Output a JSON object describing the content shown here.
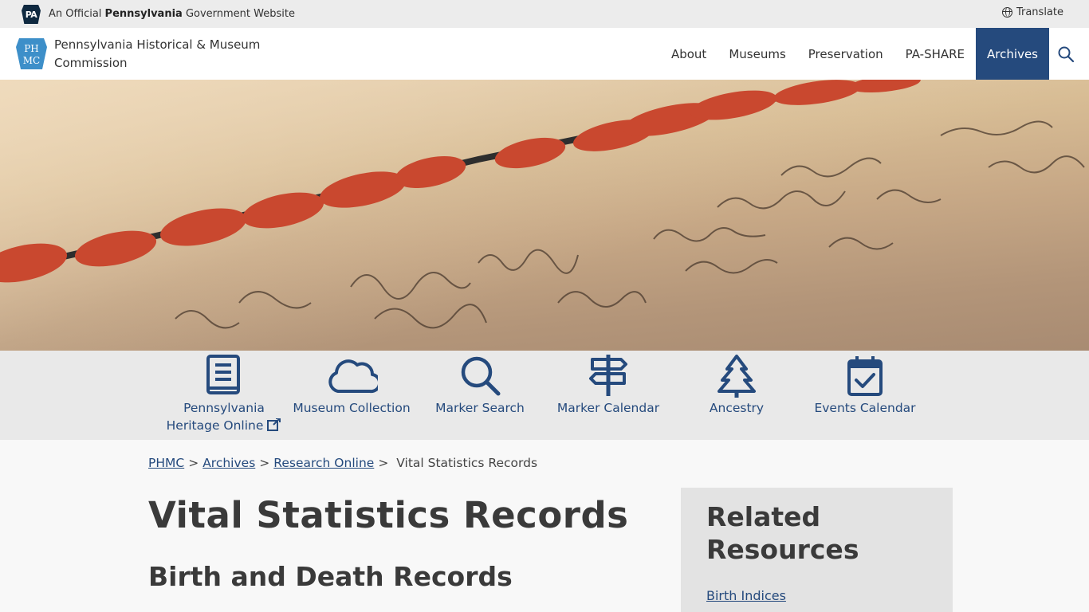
{
  "official_bar": {
    "prefix": "An Official ",
    "state": "Pennsylvania",
    "suffix": " Government Website",
    "badge": "PA",
    "translate_label": "Translate"
  },
  "header": {
    "site_name": "Pennsylvania Historical & Museum Commission",
    "logo_text": "PHMC",
    "nav": [
      {
        "label": "About"
      },
      {
        "label": "Museums"
      },
      {
        "label": "Preservation"
      },
      {
        "label": "PA-SHARE"
      },
      {
        "label": "Archives",
        "active": true
      }
    ]
  },
  "quicklinks": [
    {
      "label": "Pennsylvania Heritage Online",
      "icon": "book-icon",
      "external": true
    },
    {
      "label": "Museum Collection",
      "icon": "cloud-icon"
    },
    {
      "label": "Marker Search",
      "icon": "search-icon"
    },
    {
      "label": "Marker Calendar",
      "icon": "signpost-icon"
    },
    {
      "label": "Ancestry",
      "icon": "tree-icon"
    },
    {
      "label": "Events Calendar",
      "icon": "calendar-check-icon"
    }
  ],
  "breadcrumb": {
    "items": [
      "PHMC",
      "Archives",
      "Research Online"
    ],
    "current": "Vital Statistics Records",
    "separator": ">"
  },
  "main": {
    "title": "Vital Statistics Records",
    "subheading": "Birth and Death Records"
  },
  "related": {
    "heading": "Related Resources",
    "links": [
      "Birth Indices"
    ]
  },
  "colors": {
    "brand_blue": "#254a7d",
    "official_bar": "#ececec",
    "quicklinks_bg": "#e9e9e9",
    "wax_seal": "#c9482f"
  }
}
